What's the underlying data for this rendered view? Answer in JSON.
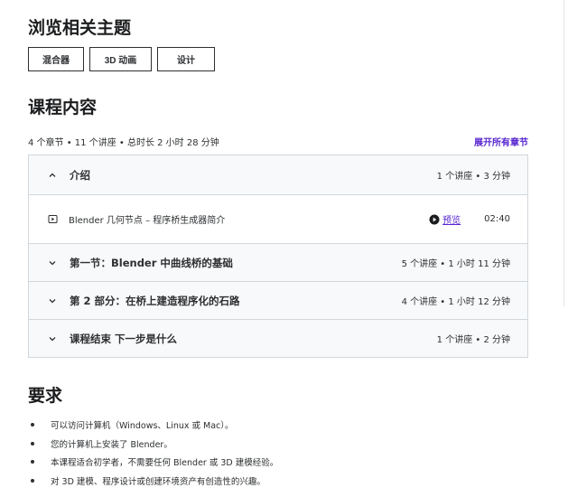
{
  "topics": {
    "title": "浏览相关主题",
    "chips": [
      "混合器",
      "3D 动画",
      "设计"
    ]
  },
  "course_content": {
    "title": "课程内容",
    "summary": "4 个章节 • 11 个讲座 • 总时长 2 小时 28 分钟",
    "expand_all": "展开所有章节",
    "sections": [
      {
        "title": "介绍",
        "meta": "1 个讲座 • 3 分钟",
        "expanded": true,
        "lectures": [
          {
            "title": "Blender 几何节点 – 程序桥生成器简介",
            "preview": "预览",
            "duration": "02:40"
          }
        ]
      },
      {
        "title": "第一节：Blender 中曲线桥的基础",
        "meta": "5 个讲座 • 1 小时 11 分钟",
        "expanded": false
      },
      {
        "title": "第 2 部分：在桥上建造程序化的石路",
        "meta": "4 个讲座 • 1 小时 12 分钟",
        "expanded": false
      },
      {
        "title": "课程结束 下一步是什么",
        "meta": "1 个讲座 • 2 分钟",
        "expanded": false
      }
    ]
  },
  "requirements": {
    "title": "要求",
    "items": [
      "可以访问计算机（Windows、Linux 或 Mac）。",
      "您的计算机上安装了 Blender。",
      "本课程适合初学者，不需要任何 Blender 或 3D 建模经验。",
      "对 3D 建模、程序设计或创建环境资产有创造性的兴趣。"
    ]
  },
  "icons": {
    "chevron_up": "chevron-up-icon",
    "chevron_down": "chevron-down-icon",
    "video": "video-icon",
    "play": "play-circle-icon"
  },
  "colors": {
    "accent": "#5624d0",
    "text": "#2d2f31",
    "section_bg": "#f7f9fa",
    "border": "#d1d7dc"
  }
}
